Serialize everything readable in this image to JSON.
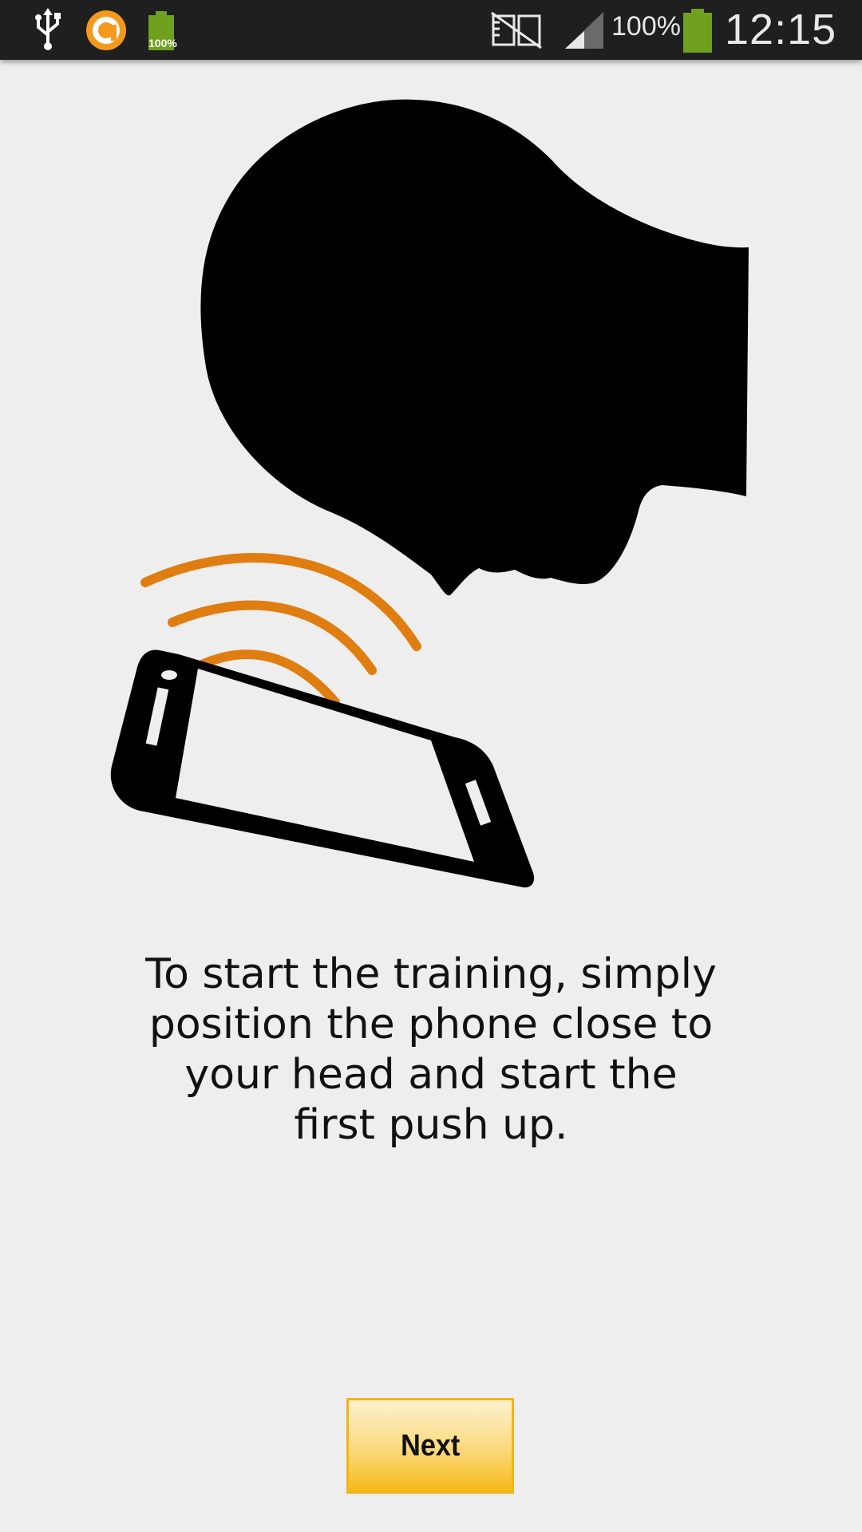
{
  "status_bar": {
    "icons": [
      "usb-icon",
      "app-notification-icon",
      "battery-small-icon",
      "no-sim-icon",
      "signal-icon",
      "battery-icon"
    ],
    "small_battery_text": "100%",
    "battery_text": "100%",
    "time": "12:15",
    "colors": {
      "background": "#1f1f1f",
      "battery": "#6fa01e",
      "app_icon": "#f39a1e"
    }
  },
  "illustration": {
    "icons": [
      "head-silhouette-icon",
      "phone-icon",
      "sound-waves-icon"
    ],
    "colors": {
      "silhouette": "#000000",
      "waves": "#e07d10"
    }
  },
  "main": {
    "instruction": "To start the training, simply position the phone close to your head and start the first push up."
  },
  "footer": {
    "next_label": "Next",
    "colors": {
      "border": "#f2b21b",
      "gradient_top": "#fdf1cf",
      "gradient_bottom": "#f6b917"
    }
  }
}
